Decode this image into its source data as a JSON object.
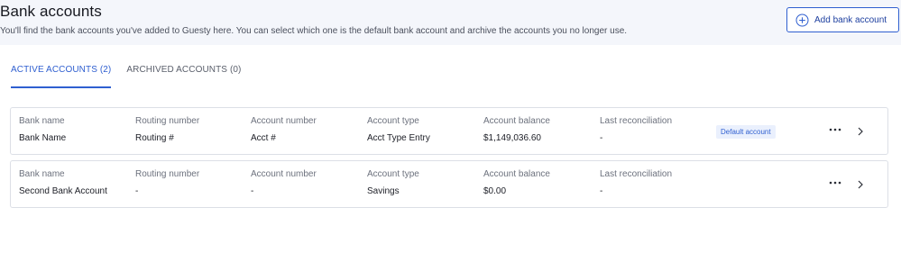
{
  "header": {
    "title": "Bank accounts",
    "subtitle": "You'll find the bank accounts you've added to Guesty here. You can select which one is the default bank account and archive the accounts you no longer use.",
    "add_button_label": "Add bank account"
  },
  "tabs": [
    {
      "label": "ACTIVE ACCOUNTS (2)",
      "active": true
    },
    {
      "label": "ARCHIVED ACCOUNTS (0)",
      "active": false
    }
  ],
  "columns": {
    "bank_name": "Bank name",
    "routing_number": "Routing number",
    "account_number": "Account number",
    "account_type": "Account type",
    "account_balance": "Account balance",
    "last_reconciliation": "Last reconciliation"
  },
  "accounts": [
    {
      "bank_name": "Bank Name",
      "routing_number": "Routing #",
      "account_number": "Acct #",
      "account_type": "Acct Type Entry",
      "account_balance": "$1,149,036.60",
      "last_reconciliation": "-",
      "badge": "Default account"
    },
    {
      "bank_name": "Second Bank Account",
      "routing_number": "-",
      "account_number": "-",
      "account_type": "Savings",
      "account_balance": "$0.00",
      "last_reconciliation": "-"
    }
  ],
  "colors": {
    "accent": "#2f5fd0",
    "header_bg": "#f4f6fb",
    "badge_bg": "#eaf0fd",
    "border": "#dcdfe6"
  },
  "icons": {
    "add": "plus-circle-icon",
    "more": "more-horizontal-icon",
    "open": "chevron-right-icon"
  }
}
